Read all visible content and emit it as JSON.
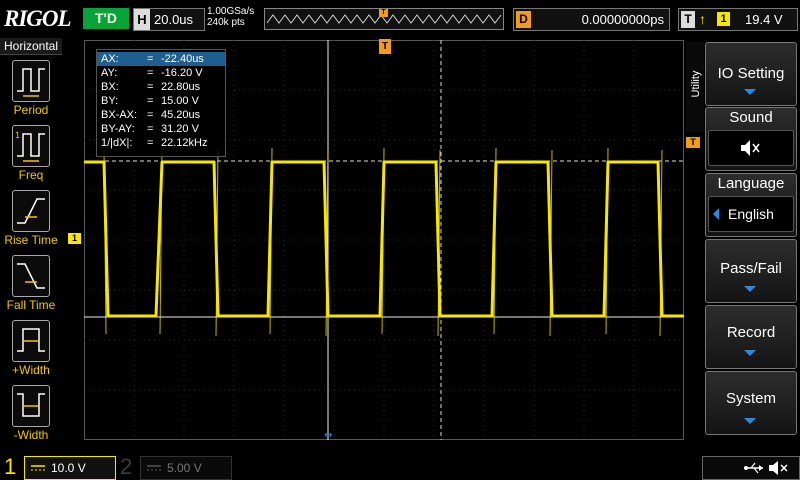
{
  "header": {
    "logo": "RIGOL",
    "run_status": "T'D",
    "horizontal": {
      "letter": "H",
      "scale": "20.0us"
    },
    "sample_rate": "1.00GSa/s",
    "memory_depth": "240k pts",
    "delay": {
      "letter": "D",
      "value": "0.00000000ps"
    },
    "trigger": {
      "letter": "T",
      "edge": "↑",
      "source": "1",
      "level": "19.4 V"
    }
  },
  "left_menu": {
    "title": "Horizontal",
    "items": [
      {
        "label": "Period",
        "icon": "period-icon"
      },
      {
        "label": "Freq",
        "icon": "frequency-icon"
      },
      {
        "label": "Rise Time",
        "icon": "rise-time-icon"
      },
      {
        "label": "Fall Time",
        "icon": "fall-time-icon"
      },
      {
        "label": "+Width",
        "icon": "positive-width-icon"
      },
      {
        "label": "-Width",
        "icon": "negative-width-icon"
      }
    ]
  },
  "cursor_readout": {
    "rows": [
      {
        "key": "AX:",
        "value": "-22.40us"
      },
      {
        "key": "AY:",
        "value": "-16.20 V"
      },
      {
        "key": "BX:",
        "value": "22.80us"
      },
      {
        "key": "BY:",
        "value": "15.00 V"
      },
      {
        "key": "BX-AX:",
        "value": "45.20us"
      },
      {
        "key": "BY-AY:",
        "value": "31.20 V"
      },
      {
        "key": "1/|dX|:",
        "value": "22.12kHz"
      }
    ],
    "equals": "="
  },
  "markers": {
    "channel1": "1",
    "trigger": "T",
    "top_trigger": "T"
  },
  "right_menu": {
    "tab_label": "Utility",
    "items": [
      {
        "title": "IO Setting"
      },
      {
        "title": "Sound"
      },
      {
        "title": "Language",
        "value": "English"
      },
      {
        "title": "Pass/Fail"
      },
      {
        "title": "Record"
      },
      {
        "title": "System"
      }
    ]
  },
  "footer": {
    "ch1": {
      "number": "1",
      "scale": "10.0 V"
    },
    "ch2": {
      "number": "2",
      "scale": "5.00 V"
    }
  },
  "colors": {
    "ch1": "#f6e600",
    "trigger": "#f39c1a",
    "accent": "#2a8be0",
    "run": "#0aa33a"
  }
}
